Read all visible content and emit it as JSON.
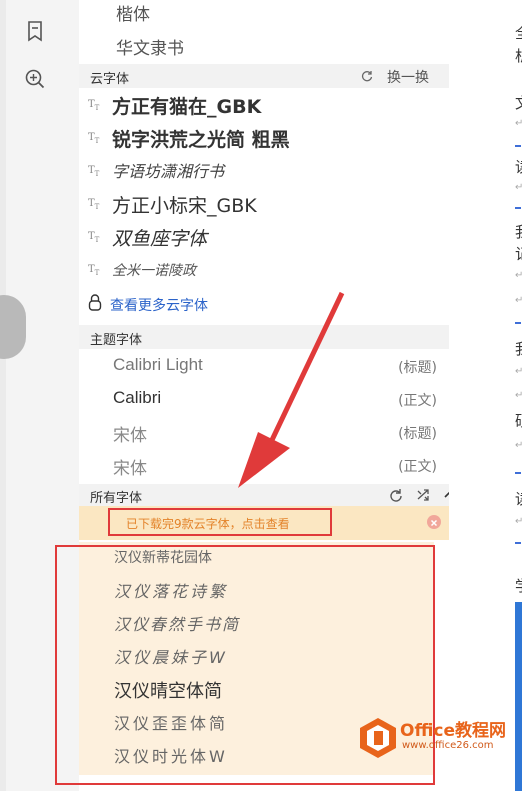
{
  "colors": {
    "accent": "#2b63c9",
    "highlight_border": "#e03a3a",
    "notice_bg": "#fbe7c2",
    "notice_text": "#e3832a",
    "row_bg": "#fdf0dd"
  },
  "top_fonts": [
    "楷体",
    "华文隶书"
  ],
  "cloud_fonts": {
    "header": "云字体",
    "refresh_label": "换一换",
    "items": [
      "方正有猫在_GBK",
      "锐字洪荒之光简 粗黑",
      "字语坊潇湘行书",
      "方正小标宋_GBK",
      "双鱼座字体",
      "全米一诺陵政"
    ],
    "more_label": "查看更多云字体"
  },
  "theme_fonts": {
    "header": "主题字体",
    "items": [
      {
        "name": "Calibri Light",
        "tag": "(标题)"
      },
      {
        "name": "Calibri",
        "tag": "(正文)"
      },
      {
        "name": "宋体",
        "tag": "(标题)"
      },
      {
        "name": "宋体",
        "tag": "(正文)"
      }
    ]
  },
  "all_fonts": {
    "header": "所有字体",
    "notice": "已下载完9款云字体，点击查看",
    "items": [
      "汉仪新蒂花园体",
      "汉仪落花诗繁",
      "汉仪春然手书简",
      "汉仪晨妹子W",
      "汉仪晴空体简",
      "汉仪歪歪体简",
      "汉仪时光体W"
    ]
  },
  "watermark": {
    "brand": "Office教程网",
    "url": "www.office26.com"
  },
  "doc_chars": [
    "全",
    "析",
    "文",
    "读",
    "我",
    "记",
    "我",
    "硕",
    "读",
    "学"
  ]
}
